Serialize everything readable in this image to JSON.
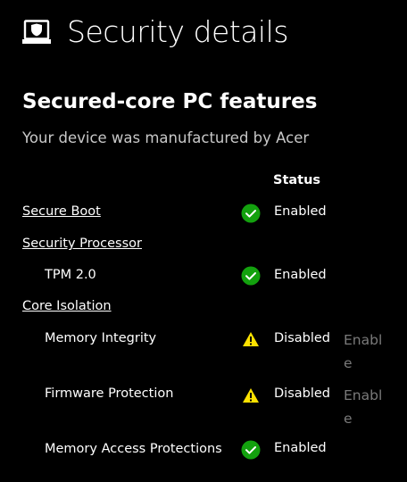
{
  "header": {
    "title": "Security details",
    "icon": "laptop-shield-icon"
  },
  "section": {
    "title": "Secured-core PC features",
    "subtitle": "Your device was manufactured by Acer",
    "status_header": "Status"
  },
  "features": {
    "secure_boot": {
      "label": "Secure Boot",
      "status": "Enabled",
      "icon": "check-circle-icon"
    },
    "security_processor": {
      "label": "Security Processor"
    },
    "tpm": {
      "label": "TPM 2.0",
      "status": "Enabled",
      "icon": "check-circle-icon"
    },
    "core_isolation": {
      "label": "Core Isolation"
    },
    "memory_integrity": {
      "label": "Memory Integrity",
      "status": "Disabled",
      "icon": "warning-icon",
      "action": "Enable"
    },
    "firmware_protection": {
      "label": "Firmware Protection",
      "status": "Disabled",
      "icon": "warning-icon",
      "action": "Enable"
    },
    "memory_access": {
      "label": "Memory Access Protections",
      "status": "Enabled",
      "icon": "check-circle-icon"
    }
  },
  "colors": {
    "background": "#000000",
    "ok": "#13a10e",
    "warning": "#fce100",
    "disabled_action": "#7a7a7a"
  }
}
